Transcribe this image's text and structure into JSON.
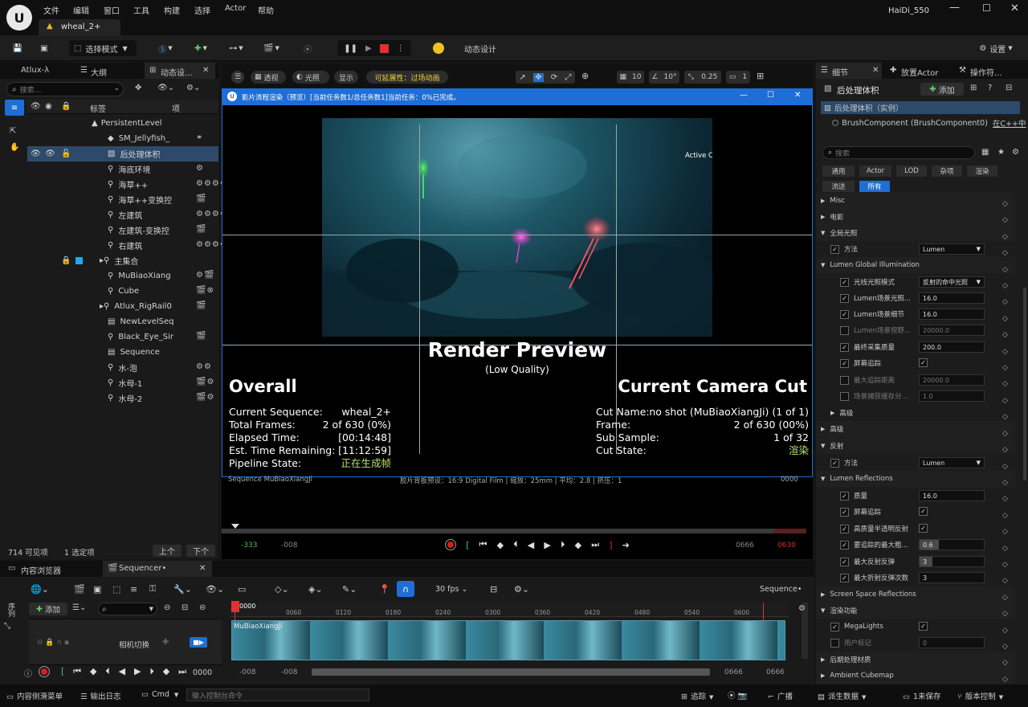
{
  "menu": [
    "文件",
    "编辑",
    "窗口",
    "工具",
    "构建",
    "选择",
    "Actor",
    "帮助"
  ],
  "project_name": "HaiDi_550",
  "level_tab": "wheal_2+",
  "toolbar": {
    "mode": "选择模式",
    "motion_design": "动态设计",
    "settings": "设置"
  },
  "left_tabs": [
    "Atlux-λ",
    "大纲",
    "动态设..."
  ],
  "search_placeholder": "搜索...",
  "outliner": {
    "col_label": "标签",
    "col_item": "项",
    "root": "PersistentLevel",
    "items": [
      "SM_Jellyfish_",
      "后处理体积",
      "海底环境",
      "海草++",
      "海草++变换控",
      "左建筑",
      "左建筑-变换控",
      "右建筑",
      "主集合",
      "MuBiaoXiang",
      "Cube",
      "Atlux_RigRail0",
      "NewLevelSeq",
      "Black_Eye_Sir",
      "Sequence",
      "水-泡",
      "水母-1",
      "水母-2"
    ],
    "footer_count": "714 可见项",
    "footer_selected": "1 选定项",
    "btn_up": "上个",
    "btn_down": "下个"
  },
  "viewport_bar": {
    "perspective": "透视",
    "lighting": "光照",
    "show": "显示",
    "scalability": "可延展性：过场动画",
    "grid": "10",
    "angle": "10°",
    "scale": "0.25",
    "camera_speed": "1"
  },
  "render_window": {
    "title": "影片流程渲染（预览）[当前任务数1/总任务数1]当前任务：0%已完成。",
    "active_camera": "Active Camera: `MuBiaoXiangJi`",
    "heading": "Render Preview",
    "subheading": "(Low Quality)",
    "overall": "Overall",
    "current_cut": "Current Camera Cut",
    "left_labels": [
      "Current Sequence:",
      "Total Frames:",
      "Elapsed Time:",
      "Est. Time Remaining:",
      "Pipeline State:"
    ],
    "left_values": [
      "wheal_2+",
      "2 of 630 (0%)",
      "[00:14:48]",
      "[11:12:59]",
      "正在生成帧"
    ],
    "right_labels": [
      "Cut Name:",
      "Frame:",
      "Sub Sample:",
      "Cut State:"
    ],
    "right_values": [
      "no shot (MuBiaoXiangJi) (1 of 1)",
      "2 of 630 (00%)",
      "1 of 32",
      "渲染"
    ]
  },
  "viewport_info": {
    "sequence": "Sequence  MuBiaoXiangJi",
    "film": "胶片背板预设：16:9 Digital Film | 缩放：25mm | 平均：2.8 | 挤压：1",
    "frame": "0000"
  },
  "playback": {
    "start_red": "-333",
    "start": "-008",
    "end": "0666",
    "end_red": "0630"
  },
  "details": {
    "tabs": [
      "细节",
      "放置Actor",
      "操作符..."
    ],
    "actor_name": "后处理体积",
    "add_button": "添加",
    "instance": "后处理体积（实例）",
    "component": "BrushComponent (BrushComponent0)",
    "component_link": "在C++中",
    "search_placeholder": "搜索",
    "filters": [
      "通用",
      "Actor",
      "LOD",
      "杂项",
      "渲染",
      "流送",
      "所有"
    ],
    "sections": {
      "misc": "Misc",
      "movie": "电影",
      "gi": "全局光照",
      "gi_method": "方法",
      "gi_method_value": "Lumen",
      "lumen_gi": "Lumen Global Illumination",
      "lumen_rows": [
        "光线光照模式",
        "Lumen场景光照...",
        "Lumen场景细节",
        "Lumen场景视野...",
        "最终采集质量",
        "屏幕追踪",
        "最大追踪距离",
        "场景捕获缓存分..."
      ],
      "lumen_values": [
        "反射的命中光照",
        "16.0",
        "16.0",
        "20000.0",
        "200.0",
        "",
        "20000.0",
        "1.0"
      ],
      "advanced": "高级",
      "advanced2": "高级",
      "reflections": "反射",
      "refl_method": "方法",
      "refl_method_value": "Lumen",
      "lumen_refl": "Lumen Reflections",
      "refl_rows": [
        "质量",
        "屏幕追踪",
        "高质量半透明反射",
        "要追踪的最大粗...",
        "最大反射反弹",
        "最大折射反弹次数"
      ],
      "refl_values": [
        "16.0",
        "",
        "",
        "0.6",
        "3",
        "3"
      ],
      "ssr": "Screen Space Reflections",
      "render_features": "渲染功能",
      "megalights": "MegaLights",
      "user_flags": "用户标记",
      "user_flags_value": "0",
      "post_material": "后期处理材质",
      "ambient": "Ambient Cubemap"
    }
  },
  "sequencer": {
    "tab_content": "内容浏览器",
    "tab_seq": "Sequencer•",
    "add": "添加",
    "fps": "30 fps",
    "seq_name": "Sequence•",
    "side_label": "序列",
    "track": "相机切换",
    "clip": "MuBiaoXiangJi",
    "ticks": [
      "0000",
      "0060",
      "0120",
      "0180",
      "0240",
      "0300",
      "0360",
      "0420",
      "0480",
      "0540",
      "0600"
    ],
    "frame_value": "0000",
    "range_a": "-008",
    "range_b": "-008",
    "range_c": "0666",
    "range_d": "0666"
  },
  "status": {
    "drawer": "内容侧滑菜单",
    "output": "输出日志",
    "cmd": "Cmd",
    "console_placeholder": "输入控制台命令",
    "trace": "追踪",
    "broadcast": "广播",
    "derived": "派生数据",
    "unsaved": "1未保存",
    "source": "版本控制"
  }
}
